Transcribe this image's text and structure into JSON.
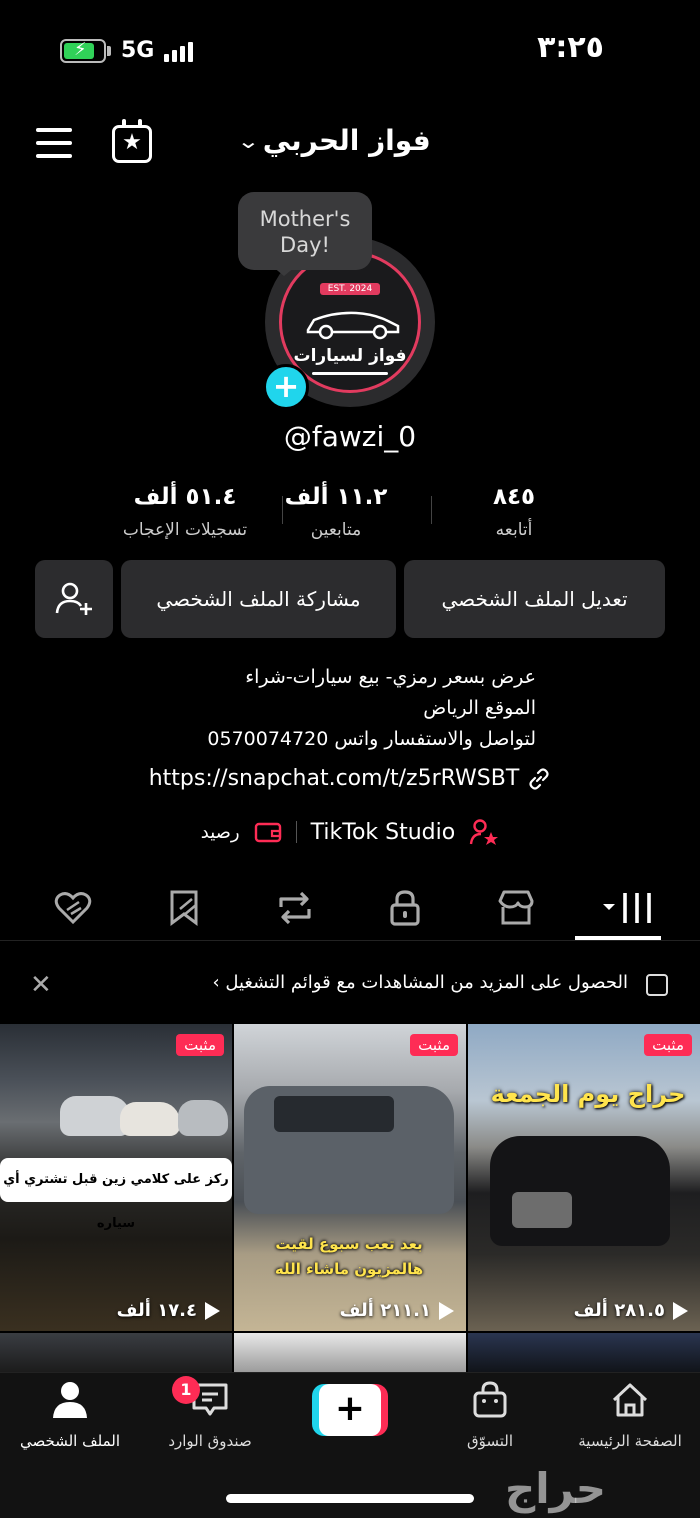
{
  "status_bar": {
    "time": "٣:٢٥",
    "network": "5G"
  },
  "header": {
    "profile_name": "فواز الحربي"
  },
  "avatar": {
    "bubble_text": "Mother's Day!",
    "logo_est": "EST. 2024",
    "logo_text": "فواز لسيارات"
  },
  "profile": {
    "handle": "@fawzi_0",
    "stats": [
      {
        "value": "٨٤٥",
        "label": "أتابعه"
      },
      {
        "value": "١١.٢ ألف",
        "label": "متابعين"
      },
      {
        "value": "٥١.٤ ألف",
        "label": "تسجيلات الإعجاب"
      }
    ]
  },
  "buttons": {
    "edit": "تعديل الملف الشخصي",
    "share": "مشاركة الملف الشخصي"
  },
  "bio": {
    "lines": [
      "عرض بسعر رمزي- بيع سيارات-شراء",
      "الموقع الرياض",
      "لتواصل والاستفسار واتس 0570074720"
    ],
    "link": "https://snapchat.com/t/z5rRWSBT",
    "studio": "TikTok Studio",
    "balance": "رصيد"
  },
  "tabs": [
    {
      "icon": "grid-icon"
    },
    {
      "icon": "shop-icon"
    },
    {
      "icon": "lock-icon"
    },
    {
      "icon": "repost-icon"
    },
    {
      "icon": "bookmark-icon"
    },
    {
      "icon": "liked-icon"
    }
  ],
  "promo": {
    "text": "الحصول على المزيد من المشاهدات مع قوائم التشغيل ›"
  },
  "videos": [
    {
      "pinned": "مثبت",
      "views": "١٧.٤ ألف",
      "caption": "ركز على كلامي زين قبل تشتري أي سياره"
    },
    {
      "pinned": "مثبت",
      "views": "٢١١.١ ألف",
      "caption": "بعد تعب سبوع لقيت هالمزيون ماشاء الله"
    },
    {
      "pinned": "مثبت",
      "views": "٢٨١.٥ ألف",
      "caption": "حراج يوم الجمعة"
    }
  ],
  "bottom_nav": {
    "home": "الصفحة الرئيسية",
    "shop": "التسوّق",
    "create": "+",
    "inbox": "صندوق الوارد",
    "inbox_badge": "1",
    "profile": "الملف الشخصي"
  },
  "watermark": "حراج",
  "colors": {
    "accent_red": "#fe2c55",
    "accent_cyan": "#20d5ec",
    "button_bg": "#2c2c2e"
  }
}
